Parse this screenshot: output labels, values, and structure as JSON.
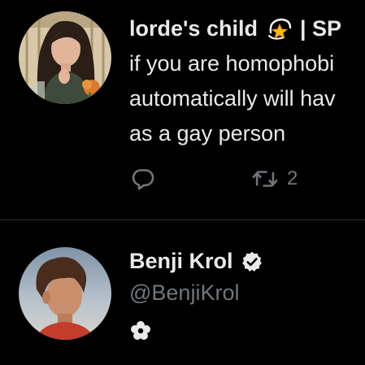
{
  "tweet_1": {
    "display_name": "lorde's child",
    "badge_icon": "dizzy-star-emoji",
    "name_suffix": "| SP",
    "text_lines": [
      "if you are homophobi",
      "automatically will hav",
      "as a gay person"
    ],
    "reply_icon": "reply-icon",
    "retweet_icon": "retweet-icon",
    "retweet_count": "2"
  },
  "tweet_2": {
    "display_name": "Benji Krol",
    "verified_icon": "verified-badge-icon",
    "handle": "@BenjiKrol",
    "bio_icon": "flower-icon"
  },
  "colors": {
    "background": "#000000",
    "primary_text": "#e7e9ea",
    "secondary_text": "#71767b",
    "divider": "#2f3336"
  }
}
